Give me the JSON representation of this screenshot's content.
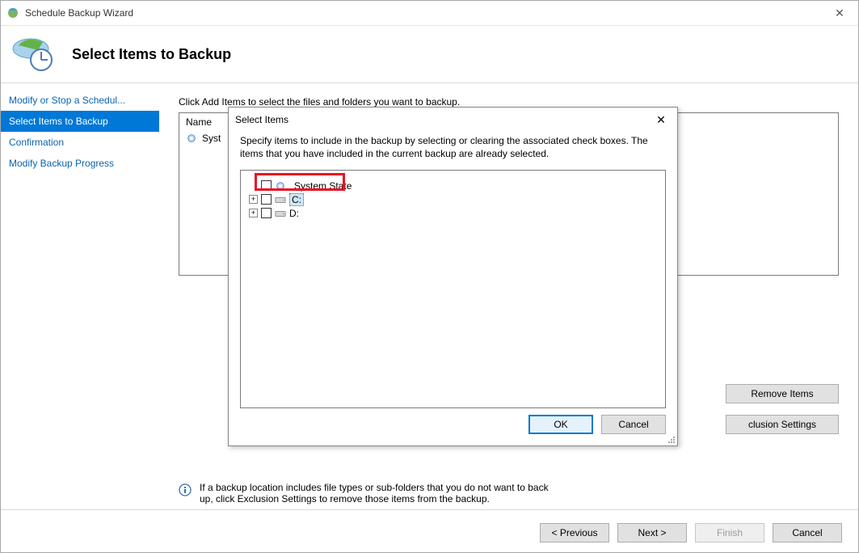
{
  "window": {
    "title": "Schedule Backup Wizard",
    "close_glyph": "✕"
  },
  "header": {
    "title": "Select Items to Backup"
  },
  "sidebar": {
    "items": [
      {
        "label": "Modify or Stop a Schedul...",
        "selected": false
      },
      {
        "label": "Select Items to Backup",
        "selected": true
      },
      {
        "label": "Confirmation",
        "selected": false
      },
      {
        "label": "Modify Backup Progress",
        "selected": false
      }
    ]
  },
  "main": {
    "instruction": "Click Add Items to select the files and folders you want to backup.",
    "list": {
      "header": "Name",
      "items": [
        {
          "label": "Syst"
        }
      ]
    },
    "side_buttons": {
      "remove": "Remove Items",
      "exclusion": "clusion Settings"
    },
    "info": "If a backup location includes file types or sub-folders that you do not want to back up, click Exclusion Settings to remove those items from the backup."
  },
  "footer": {
    "previous": "< Previous",
    "next": "Next >",
    "finish": "Finish",
    "cancel": "Cancel"
  },
  "dialog": {
    "title": "Select Items",
    "close_glyph": "✕",
    "description": "Specify items to include in the backup by selecting or clearing the associated check boxes. The items that you have included in the current backup are already selected.",
    "tree": {
      "items": [
        {
          "expandable": false,
          "label": "System State",
          "icon": "gear",
          "selected": false,
          "highlighted": true
        },
        {
          "expandable": true,
          "label": "C:",
          "icon": "drive",
          "selected": true
        },
        {
          "expandable": true,
          "label": "D:",
          "icon": "drive",
          "selected": false
        }
      ]
    },
    "ok": "OK",
    "cancel": "Cancel"
  }
}
